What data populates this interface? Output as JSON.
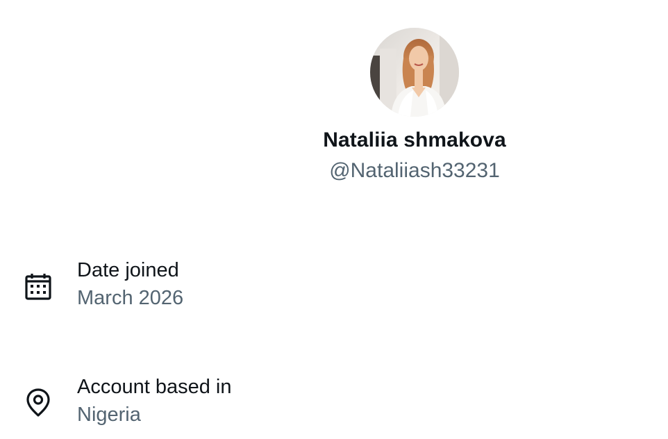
{
  "profile": {
    "display_name": "Nataliia shmakova",
    "handle": "@Nataliiash33231",
    "avatar_icon": "profile-photo"
  },
  "details": {
    "date_joined": {
      "icon": "calendar-icon",
      "label": "Date joined",
      "value": "March 2026"
    },
    "location": {
      "icon": "location-pin-icon",
      "label": "Account based in",
      "value": "Nigeria"
    }
  },
  "colors": {
    "primary_text": "#0f1419",
    "secondary_text": "#536471",
    "background": "#ffffff"
  }
}
